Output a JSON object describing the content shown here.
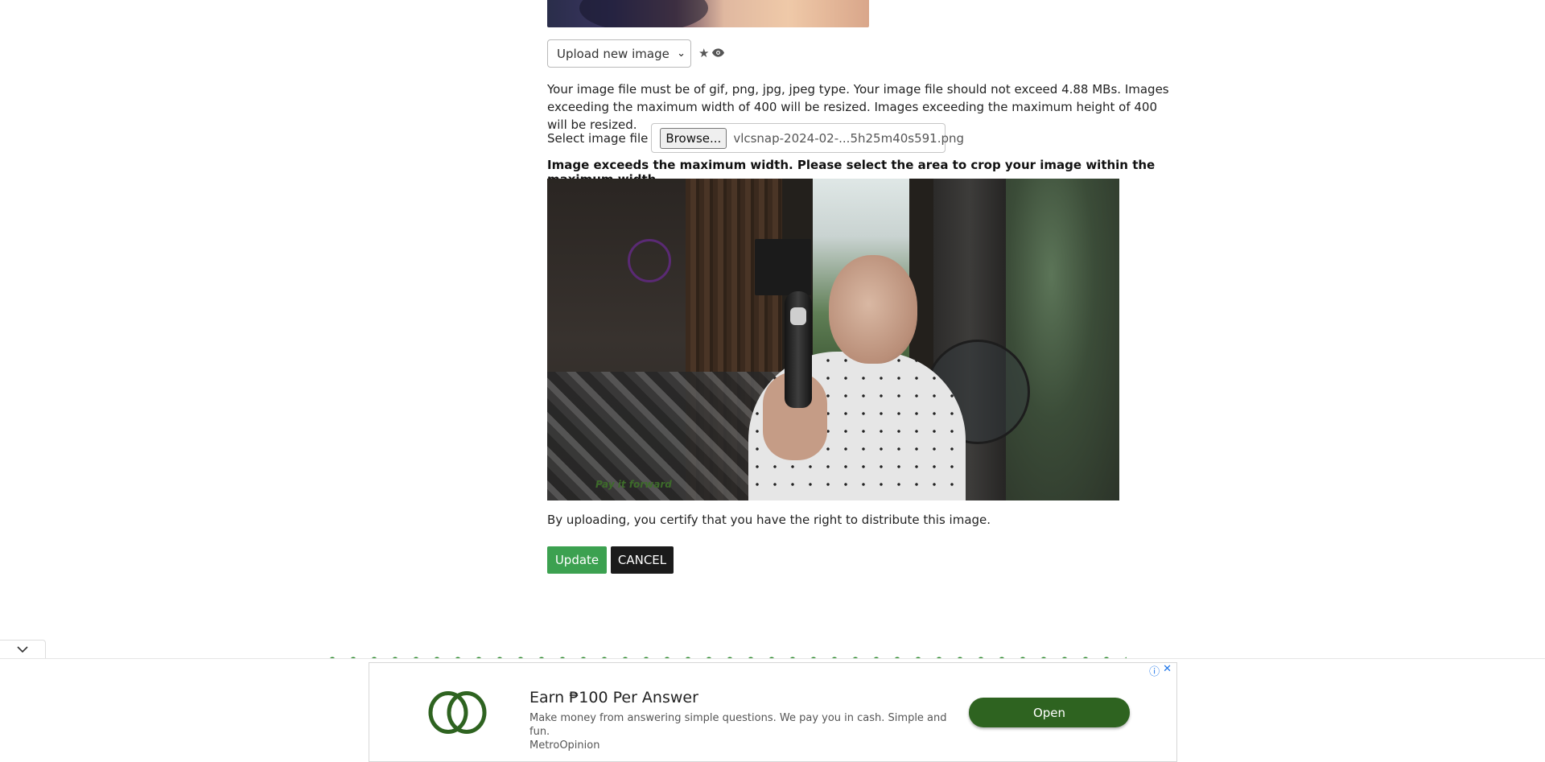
{
  "form": {
    "select_value": "Upload new image",
    "info_text": "Your image file must be of gif, png, jpg, jpeg type. Your image file should not exceed 4.88 MBs. Images exceeding the maximum width of 400 will be resized. Images exceeding the maximum height of 400 will be resized.",
    "select_file_label": "Select image file",
    "browse_label": "Browse...",
    "file_name": "vlcsnap-2024-02-...5h25m40s591.png",
    "warning_text": "Image exceeds the maximum width. Please select the area to crop your image within the maximum width.",
    "image_caption": "Pay it forward",
    "certify_text": "By uploading, you certify that you have the right to distribute this image.",
    "update_label": "Update",
    "cancel_label": "CANCEL"
  },
  "icons": {
    "select_arrow": "chevron-down-icon",
    "star": "star-icon",
    "eye": "eye-icon",
    "collapse": "chevron-down-icon"
  },
  "ad": {
    "title": "Earn ₱100 Per Answer",
    "description": "Make money from answering simple questions. We pay you in cash. Simple and fun.",
    "advertiser": "MetroOpinion",
    "cta_label": "Open",
    "cta_color": "#2e6320"
  },
  "colors": {
    "update_button": "#3ca150",
    "cancel_button": "#1b1b1b"
  }
}
